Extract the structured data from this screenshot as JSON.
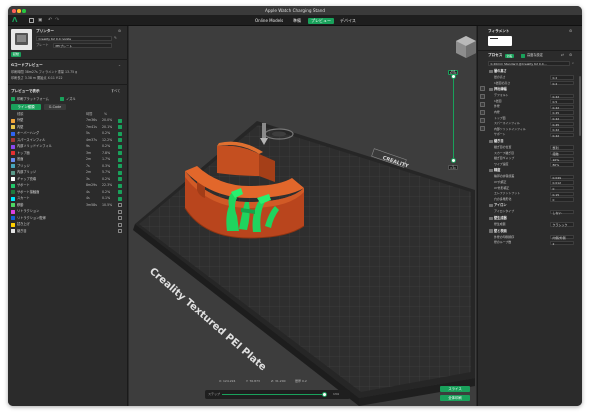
{
  "app": {
    "title": "Apple Watch Charging Stand",
    "tabs": [
      "Online Models",
      "準備",
      "プレビュー",
      "デバイス"
    ],
    "active_tab": 2,
    "accent": "#19a15b"
  },
  "printer": {
    "heading": "プリンター",
    "model": "Creality K2 0.4 nozzle",
    "plate_label": "プレート",
    "plate_value": "PEIプレート",
    "badge": "起動"
  },
  "gcode": {
    "heading": "Gコードプレビュー",
    "line1": "印刷時間 38m27s   フィラメント重量 13.75 g",
    "line2": "印刷長さ 3.38 m   開始点 X:11 Y:22"
  },
  "preview": {
    "heading": "プレビューで表示",
    "toggle_label": "すべて",
    "chk_build_plate": "印刷プラットフォーム",
    "chk_travel": "ノズル",
    "btn_type": "ライン種類",
    "btn_gcode": "G-Code",
    "col_type": "種類",
    "col_time": "時間",
    "col_pct": "%",
    "items": [
      {
        "name": "外壁",
        "time": "7m36s",
        "pct": "20.0%",
        "color": "#f3a63c",
        "on": true
      },
      {
        "name": "内壁",
        "time": "7m41s",
        "pct": "20.1%",
        "color": "#eac64b",
        "on": true
      },
      {
        "name": "オーバーハング",
        "time": "5s",
        "pct": "0.2%",
        "color": "#2f64f0",
        "on": true
      },
      {
        "name": "スパースインフィル",
        "time": "4m37s",
        "pct": "12.2%",
        "color": "#a53736",
        "on": true
      },
      {
        "name": "内部ソリッドインフィル",
        "time": "9s",
        "pct": "0.2%",
        "color": "#8a48f2",
        "on": true
      },
      {
        "name": "トップ面",
        "time": "3m",
        "pct": "7.8%",
        "color": "#e73031",
        "on": true
      },
      {
        "name": "底面",
        "time": "2m",
        "pct": "1.7%",
        "color": "#6b8bf0",
        "on": true
      },
      {
        "name": "ブリッジ",
        "time": "7s",
        "pct": "0.3%",
        "color": "#48a6bd",
        "on": true
      },
      {
        "name": "内部ブリッジ",
        "time": "2m",
        "pct": "5.7%",
        "color": "#5a9a8a",
        "on": true
      },
      {
        "name": "ギャップ充填",
        "time": "3s",
        "pct": "0.2%",
        "color": "#ffffff",
        "on": true
      },
      {
        "name": "サポート",
        "time": "8m29s",
        "pct": "22.3%",
        "color": "#22c86a",
        "on": true
      },
      {
        "name": "サポート接触面",
        "time": "4s",
        "pct": "0.2%",
        "color": "#1f7a3e",
        "on": true
      },
      {
        "name": "スカート",
        "time": "4s",
        "pct": "0.1%",
        "color": "#00eaff",
        "on": true
      },
      {
        "name": "移動",
        "time": "3m58s",
        "pct": "10.5%",
        "color": "#4cd964",
        "on": false
      },
      {
        "name": "リトラクション",
        "time": "",
        "pct": "",
        "color": "#e040e0",
        "on": false
      },
      {
        "name": "リトラクション復帰",
        "time": "",
        "pct": "",
        "color": "#1560d6",
        "on": false
      },
      {
        "name": "拭き上げ",
        "time": "",
        "pct": "",
        "color": "#ffd000",
        "on": false
      },
      {
        "name": "継ぎ目",
        "time": "",
        "pct": "",
        "color": "#e6e6e6",
        "on": false
      }
    ]
  },
  "viewport": {
    "plate_text": "Creality Textured PEI Plate",
    "brand": "CREALITY",
    "layer_top": "164\n32.80",
    "layer_bottom": "1\n0.20",
    "coords": [
      "X: 124.224",
      "Y: 76.873",
      "Z: 31.200",
      "層厚 0.2"
    ],
    "slider_label": "ステップ",
    "slider_value": "134"
  },
  "right_panel": {
    "filament_heading": "フィラメント",
    "filament_color": "#ffffff",
    "process_heading": "プロセス",
    "process_toggle": "全般",
    "advanced_label": "高度な設定",
    "preset": "0.20mm Standard @Creality K2 0.4…",
    "sections": [
      {
        "title": "層の高さ",
        "rows": [
          [
            "層の高さ",
            "0.2"
          ],
          [
            "1層目の高さ",
            "0.2"
          ]
        ]
      },
      {
        "title": "押出線幅",
        "rows": [
          [
            "デフォルト",
            "0.42"
          ],
          [
            "1層目",
            "0.5"
          ],
          [
            "外壁",
            "0.42"
          ],
          [
            "内壁",
            "0.45"
          ],
          [
            "トップ面",
            "0.42"
          ],
          [
            "スパースインフィル",
            "0.45"
          ],
          [
            "内部ソリッドインフィル",
            "0.42"
          ],
          [
            "サポート",
            "0.42"
          ]
        ]
      },
      {
        "title": "継ぎ目",
        "rows": [
          [
            "継ぎ目の位置",
            "整列"
          ],
          [
            "スカーフ継ぎ目",
            "接触"
          ],
          [
            "継ぎ目ギャップ",
            "10%"
          ],
          [
            "ワイプ速度",
            "80%"
          ]
        ]
      },
      {
        "title": "精度",
        "rows": [
          [
            "輪郭の許容誤差",
            "0.049"
          ],
          [
            "XY穴補正",
            "0.012"
          ],
          [
            "XY外形補正",
            "0"
          ],
          [
            "エレファントフット",
            "0.15"
          ],
          [
            "穴の多角形化",
            "0"
          ]
        ]
      },
      {
        "title": "アイロン",
        "rows": [
          [
            "アイロンタイプ",
            "しない"
          ]
        ]
      },
      {
        "title": "壁生成器",
        "rows": [
          [
            "壁生成器",
            "クラシック"
          ]
        ]
      },
      {
        "title": "壁と表面",
        "rows": [
          [
            "外壁の印刷順序",
            "内側/外側"
          ],
          [
            "壁のループ数",
            "2"
          ]
        ]
      }
    ]
  },
  "bottom_buttons": {
    "slice": "スライス",
    "print": "全体印刷"
  }
}
